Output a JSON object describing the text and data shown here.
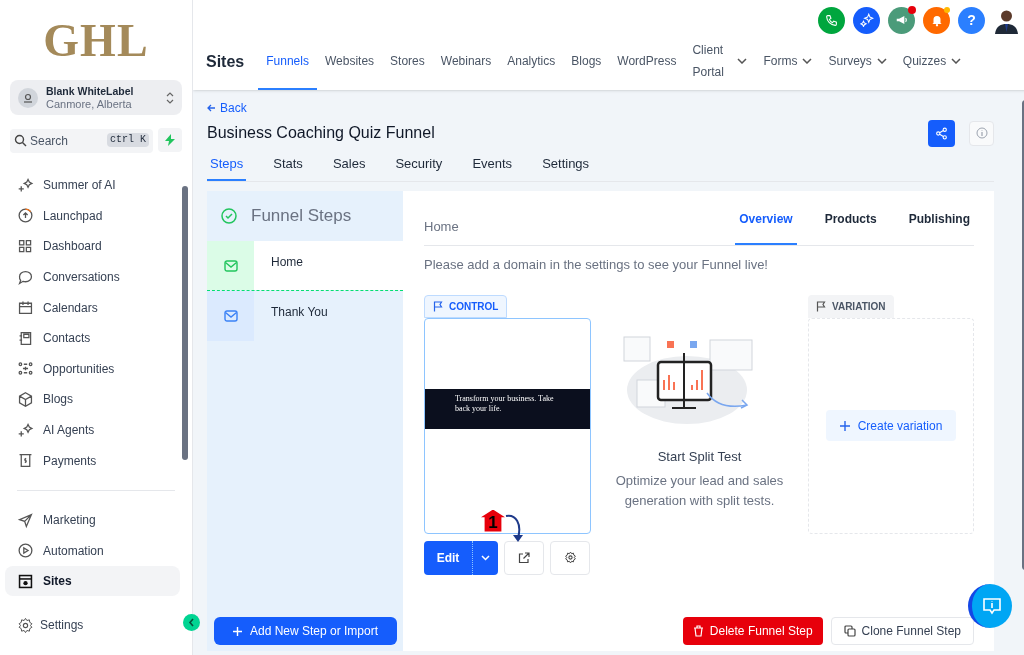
{
  "logo": "GHL",
  "account": {
    "name": "Blank WhiteLabel",
    "location": "Canmore, Alberta"
  },
  "search": {
    "placeholder": "Search",
    "shortcut": "ctrl K"
  },
  "sidebar": {
    "items": [
      {
        "label": "Summer of AI",
        "selected": false
      },
      {
        "label": "Launchpad",
        "selected": false
      },
      {
        "label": "Dashboard",
        "selected": false
      },
      {
        "label": "Conversations",
        "selected": false
      },
      {
        "label": "Calendars",
        "selected": false
      },
      {
        "label": "Contacts",
        "selected": false
      },
      {
        "label": "Opportunities",
        "selected": false
      },
      {
        "label": "Blogs",
        "selected": false
      },
      {
        "label": "AI Agents",
        "selected": false
      },
      {
        "label": "Payments",
        "selected": false
      }
    ],
    "section_items": [
      {
        "label": "Marketing",
        "selected": false
      },
      {
        "label": "Automation",
        "selected": false
      },
      {
        "label": "Sites",
        "selected": true
      }
    ],
    "settings": "Settings"
  },
  "header": {
    "title": "Sites",
    "help_label": "?",
    "nav": [
      {
        "label": "Funnels",
        "selected": true,
        "dropdown": false
      },
      {
        "label": "Websites",
        "selected": false,
        "dropdown": false
      },
      {
        "label": "Stores",
        "selected": false,
        "dropdown": false
      },
      {
        "label": "Webinars",
        "selected": false,
        "dropdown": false
      },
      {
        "label": "Analytics",
        "selected": false,
        "dropdown": false
      },
      {
        "label": "Blogs",
        "selected": false,
        "dropdown": false
      },
      {
        "label": "WordPress",
        "selected": false,
        "dropdown": false
      },
      {
        "label": "Client Portal",
        "selected": false,
        "dropdown": true
      },
      {
        "label": "Forms",
        "selected": false,
        "dropdown": true
      },
      {
        "label": "Surveys",
        "selected": false,
        "dropdown": true
      },
      {
        "label": "Quizzes",
        "selected": false,
        "dropdown": true
      }
    ]
  },
  "back": "Back",
  "funnel": {
    "title": "Business Coaching Quiz Funnel",
    "tabs": [
      {
        "label": "Steps",
        "selected": true
      },
      {
        "label": "Stats",
        "selected": false
      },
      {
        "label": "Sales",
        "selected": false
      },
      {
        "label": "Security",
        "selected": false
      },
      {
        "label": "Events",
        "selected": false
      },
      {
        "label": "Settings",
        "selected": false
      }
    ]
  },
  "steps": {
    "title": "Funnel Steps",
    "items": [
      {
        "label": "Home",
        "selected": true
      },
      {
        "label": "Thank You",
        "selected": false
      }
    ],
    "add_button": "Add New Step or Import"
  },
  "page": {
    "name": "Home",
    "tabs": [
      {
        "label": "Overview",
        "selected": true
      },
      {
        "label": "Products",
        "selected": false
      },
      {
        "label": "Publishing",
        "selected": false
      }
    ],
    "notice": "Please add a domain in the settings to see your Funnel live!",
    "control": {
      "badge": "CONTROL",
      "preview_text": "Transform your business. Take back your life.",
      "edit": "Edit"
    },
    "annotation": "1",
    "split": {
      "title": "Start Split Test",
      "description": "Optimize your lead and sales generation with split tests."
    },
    "variation": {
      "badge": "VARIATION",
      "button": "Create variation"
    },
    "delete_button": "Delete Funnel Step",
    "clone_button": "Clone Funnel Step"
  }
}
